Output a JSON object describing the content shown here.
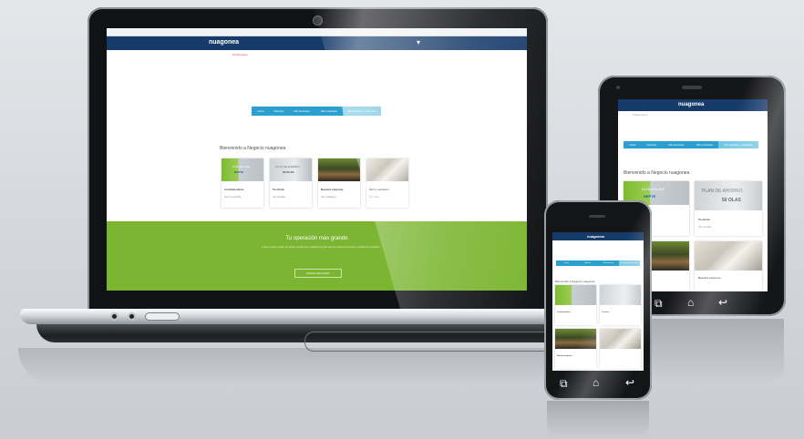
{
  "site": {
    "logo": "nuagonea",
    "breadcrumb": "Portal Home",
    "nav_tabs": [
      "Inicio",
      "Nombre",
      "Mis servicios",
      "Mis contratos",
      "Mis pedidos y reservas"
    ],
    "welcome": "Bienvenido a Negocio nuagonea",
    "cards": [
      {
        "title": "Contrata ahora",
        "subtitle": "Haz tu pedido",
        "banner": "ALTA ONLINE",
        "banner_sub": "NEPTE"
      },
      {
        "title": "Tu oferta",
        "subtitle": "Ver detalle",
        "banner": "PLAN DE AHORRO",
        "banner_sub": "50 OLAS"
      },
      {
        "title": "Nuestra empresa",
        "subtitle": "Ver catálogo",
        "banner": "",
        "banner_sub": ""
      },
      {
        "title": "Otros servicios",
        "subtitle": "Ver más",
        "banner": "",
        "banner_sub": ""
      }
    ],
    "green_band": {
      "title": "Tu operación más grande",
      "text": "Lorem ipsum dolor sit amet consectetur adipiscing elit sed do eiusmod tempor incididunt ut labore",
      "button": "Solicita información"
    }
  },
  "colors": {
    "header": "#163b6a",
    "tab": "#2c9fd1",
    "tab_active": "#74c7e3",
    "green": "#7bb531",
    "device_frame": "#1b1c1e"
  },
  "icons": {
    "android_nav": [
      "recent-apps-icon",
      "home-icon",
      "back-icon"
    ],
    "laptop_ports": [
      "port-icon",
      "port-icon",
      "usb-port-icon"
    ]
  }
}
